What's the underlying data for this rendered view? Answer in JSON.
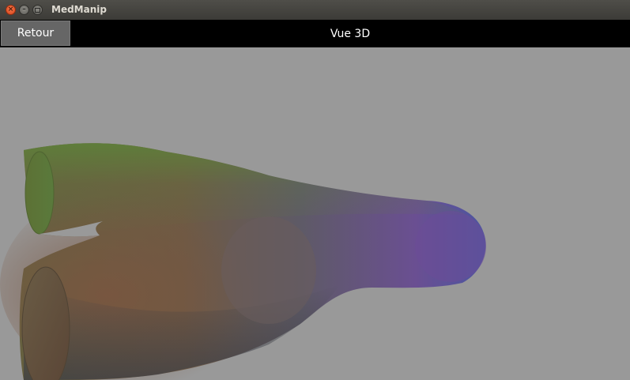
{
  "window": {
    "title": "MedManip",
    "close_icon": "close-icon",
    "minimize_icon": "minimize-icon",
    "maximize_icon": "maximize-icon"
  },
  "toolbar": {
    "back_label": "Retour",
    "view_title": "Vue 3D"
  },
  "viewport": {
    "background": "#999999",
    "model": "3D vessel model with normal-colored shading"
  },
  "colors": {
    "titlebar": "#3c3b37",
    "toolbar": "#000000",
    "button": "#666666",
    "model_green": "#5a7a3c",
    "model_brown": "#70523f",
    "model_purple": "#6e4f92",
    "model_blue": "#4a5aa0"
  }
}
